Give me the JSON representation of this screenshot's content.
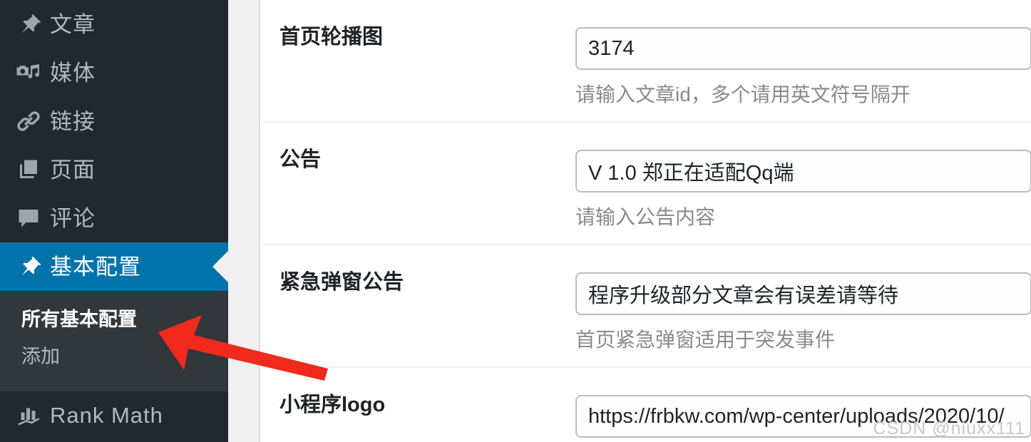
{
  "colors": {
    "sidebar_bg": "#23282d",
    "sidebar_submenu_bg": "#32373c",
    "sidebar_active_bg": "#0073aa",
    "sidebar_text": "#b4b9be",
    "content_bg": "#ffffff",
    "gap_strip": "#f0f0f1",
    "annotation_red": "#f02a1d",
    "input_border": "#b8bcc0",
    "help_text": "#8a8a8a"
  },
  "sidebar": {
    "items": [
      {
        "label": "文章",
        "icon": "pushpin-icon",
        "active": false
      },
      {
        "label": "媒体",
        "icon": "media-camera-note-icon",
        "active": false
      },
      {
        "label": "链接",
        "icon": "link-chain-icon",
        "active": false
      },
      {
        "label": "页面",
        "icon": "pages-icon",
        "active": false
      },
      {
        "label": "评论",
        "icon": "comment-bubble-icon",
        "active": false
      },
      {
        "label": "基本配置",
        "icon": "pushpin-icon",
        "active": true
      }
    ],
    "submenu": [
      {
        "label": "所有基本配置",
        "current": true
      },
      {
        "label": "添加",
        "current": false
      }
    ],
    "bottom_items": [
      {
        "label": "Rank Math",
        "icon": "bar-chart-arrow-icon",
        "active": false
      }
    ]
  },
  "form": {
    "rows": [
      {
        "label": "首页轮播图",
        "value": "3174",
        "help": "请输入文章id，多个请用英文符号隔开"
      },
      {
        "label": "公告",
        "value": "V 1.0 郑正在适配Qq端",
        "help": "请输入公告内容"
      },
      {
        "label": "紧急弹窗公告",
        "value": "程序升级部分文章会有误差请等待",
        "help": "首页紧急弹窗适用于突发事件"
      },
      {
        "label": "小程序logo",
        "value": "https://frbkw.com/wp-center/uploads/2020/10/",
        "help": ""
      }
    ]
  },
  "annotation": {
    "arrow_color": "#f02a1d",
    "points_to": "所有基本配置"
  },
  "watermark": {
    "text": "CSDN @niuxx111"
  }
}
